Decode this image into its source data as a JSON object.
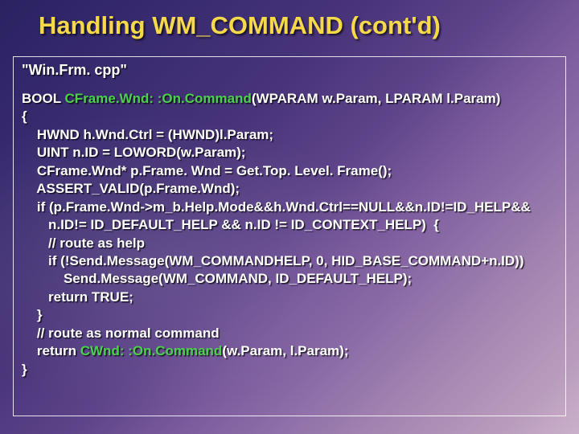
{
  "title": "Handling WM_COMMAND (cont'd)",
  "file_label": "\"Win.Frm. cpp\"",
  "code": {
    "l1a": "BOOL ",
    "fn1": "CFrame.Wnd: :On.Command",
    "l1b": "(WPARAM w.Param, LPARAM l.Param)",
    "l2": "{",
    "l3": "    HWND h.Wnd.Ctrl = (HWND)l.Param;",
    "l4": "    UINT n.ID = LOWORD(w.Param);",
    "l5": "    CFrame.Wnd* p.Frame. Wnd = Get.Top. Level. Frame();",
    "l6": "    ASSERT_VALID(p.Frame.Wnd);",
    "l7": "    if (p.Frame.Wnd->m_b.Help.Mode&&h.Wnd.Ctrl==NULL&&n.ID!=ID_HELP&&",
    "l8": "       n.ID!= ID_DEFAULT_HELP && n.ID != ID_CONTEXT_HELP)  {",
    "l9": "       // route as help",
    "l10": "       if (!Send.Message(WM_COMMANDHELP, 0, HID_BASE_COMMAND+n.ID))",
    "l11": "           Send.Message(WM_COMMAND, ID_DEFAULT_HELP);",
    "l12": "       return TRUE;",
    "l13": "    }",
    "l14": "    // route as normal command",
    "l15a": "    return ",
    "fn2": "CWnd: :On.Command",
    "l15b": "(w.Param, l.Param);",
    "l16": "}"
  }
}
